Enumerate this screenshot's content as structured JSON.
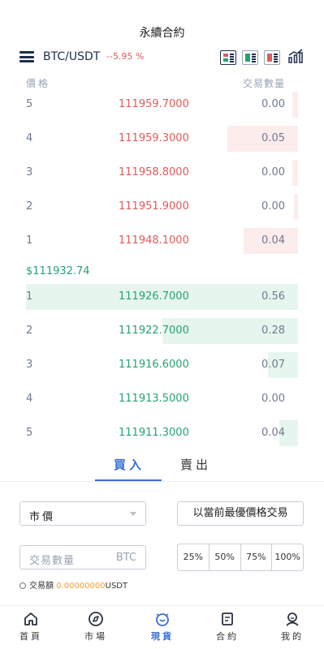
{
  "page_title": "永續合約",
  "pair": {
    "symbol": "BTC/USDT",
    "change": "--5.95 %"
  },
  "icons": {
    "menu": "hamburger-menu-icon",
    "layout_both": "orderbook-both-icon",
    "layout_buy": "orderbook-buy-icon",
    "layout_sell": "orderbook-sell-icon",
    "chart": "chart-icon"
  },
  "colors": {
    "sell": "#e05b5b",
    "buy": "#25a36f",
    "accent": "#3a6fd0",
    "amount": "#f0a030"
  },
  "orderbook": {
    "header_price": "價格",
    "header_qty": "交易數量",
    "asks": [
      {
        "idx": "5",
        "price": "111959.7000",
        "qty": "0.00",
        "depth": 0.02
      },
      {
        "idx": "4",
        "price": "111959.3000",
        "qty": "0.05",
        "depth": 0.26
      },
      {
        "idx": "3",
        "price": "111958.8000",
        "qty": "0.00",
        "depth": 0.02
      },
      {
        "idx": "2",
        "price": "111951.9000",
        "qty": "0.00",
        "depth": 0.01
      },
      {
        "idx": "1",
        "price": "111948.1000",
        "qty": "0.04",
        "depth": 0.2
      }
    ],
    "last_price": "$111932.74",
    "bids": [
      {
        "idx": "1",
        "price": "111926.7000",
        "qty": "0.56",
        "depth": 1.0
      },
      {
        "idx": "2",
        "price": "111922.7000",
        "qty": "0.28",
        "depth": 0.5
      },
      {
        "idx": "3",
        "price": "111916.6000",
        "qty": "0.07",
        "depth": 0.11
      },
      {
        "idx": "4",
        "price": "111913.5000",
        "qty": "0.00",
        "depth": 0.0
      },
      {
        "idx": "5",
        "price": "111911.3000",
        "qty": "0.04",
        "depth": 0.07
      }
    ]
  },
  "tabs": {
    "buy": "買入",
    "sell": "賣出"
  },
  "form": {
    "order_type": "市價",
    "best_price_button": "以當前最優價格交易",
    "qty_placeholder": "交易數量",
    "qty_unit": "BTC",
    "percents": [
      "25%",
      "50%",
      "75%",
      "100%"
    ],
    "amount_label": "交易額",
    "amount_value": "0.00000000",
    "amount_unit": "USDT"
  },
  "nav": [
    {
      "label": "首頁",
      "icon": "home-icon"
    },
    {
      "label": "市場",
      "icon": "market-icon"
    },
    {
      "label": "現貨",
      "icon": "spot-icon"
    },
    {
      "label": "合約",
      "icon": "contract-icon"
    },
    {
      "label": "我的",
      "icon": "profile-icon"
    }
  ]
}
